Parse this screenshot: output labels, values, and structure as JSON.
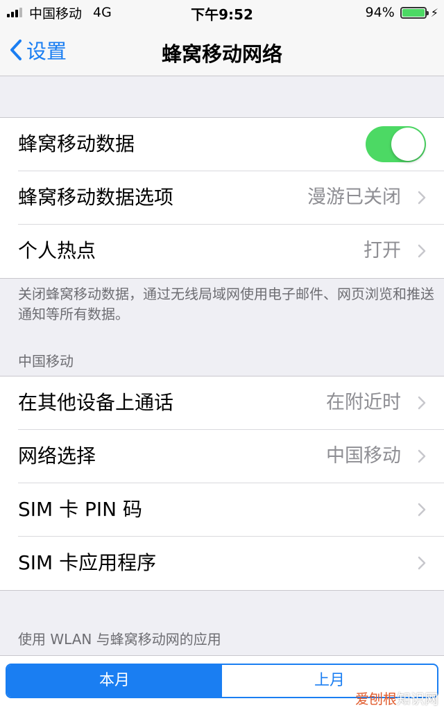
{
  "status_bar": {
    "carrier": "中国移动",
    "network": "4G",
    "time": "下午9:52",
    "battery_text": "94%",
    "battery_level": 0.94
  },
  "nav": {
    "back_label": "设置",
    "title": "蜂窝移动网络"
  },
  "group1": {
    "cellular_data_label": "蜂窝移动数据",
    "cellular_data_on": true,
    "data_options_label": "蜂窝移动数据选项",
    "data_options_value": "漫游已关闭",
    "hotspot_label": "个人热点",
    "hotspot_value": "打开"
  },
  "group1_footer": "关闭蜂窝移动数据，通过无线局域网使用电子邮件、网页浏览和推送通知等所有数据。",
  "carrier_section": {
    "header": "中国移动",
    "calls_other_devices_label": "在其他设备上通话",
    "calls_other_devices_value": "在附近时",
    "network_selection_label": "网络选择",
    "network_selection_value": "中国移动",
    "sim_pin_label": "SIM 卡 PIN 码",
    "sim_apps_label": "SIM 卡应用程序"
  },
  "apps_section": {
    "header": "使用 WLAN 与蜂窝移动网的应用"
  },
  "segmented": {
    "this_month": "本月",
    "last_month": "上月"
  },
  "watermark": {
    "brand": "爱刨根",
    "suffix": "知识网"
  },
  "colors": {
    "accent": "#1a7ef2",
    "toggle_on": "#4cd964",
    "background": "#efeff4"
  }
}
